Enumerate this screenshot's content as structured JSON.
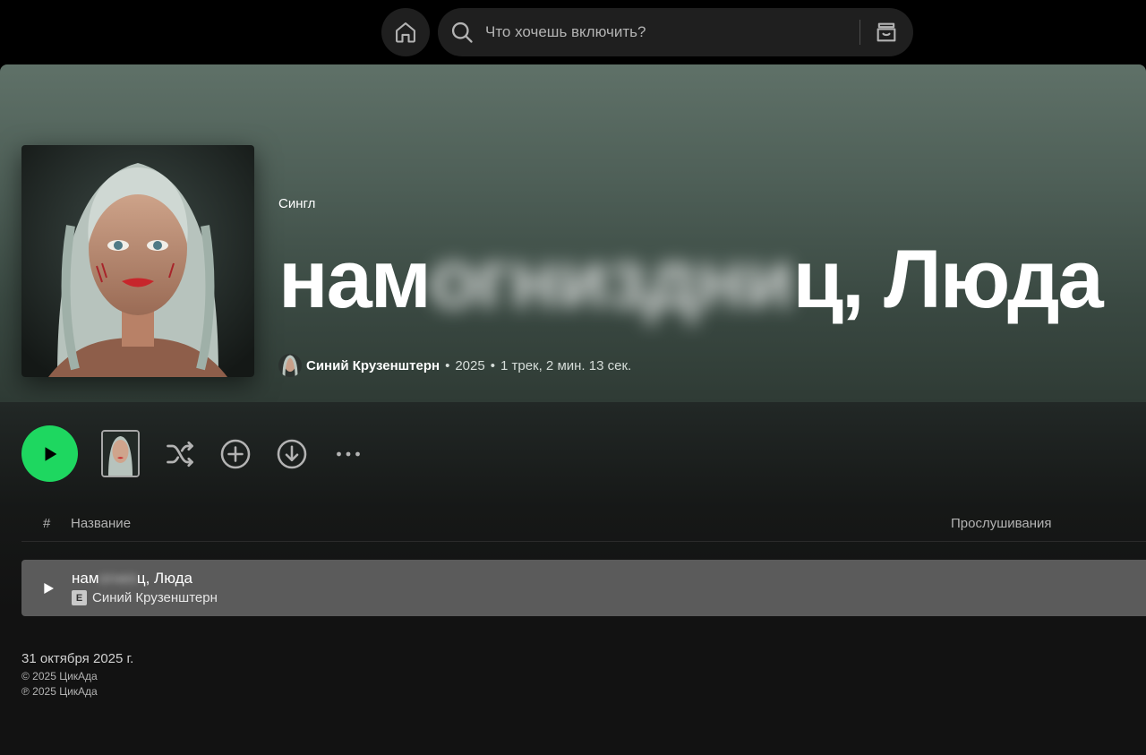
{
  "search": {
    "placeholder": "Что хочешь включить?"
  },
  "album": {
    "type_label": "Сингл",
    "title_start": "нам",
    "title_blurred": "огниздни",
    "title_end": "ц, Люда",
    "artist": "Синий Крузенштерн",
    "year": "2025",
    "tracks_duration": "1 трек, 2 мин. 13 сек.",
    "separator": "•"
  },
  "controls": {
    "play": "play-icon",
    "shuffle": "shuffle-icon",
    "add": "add-circle-icon",
    "download": "download-icon",
    "more": "more-icon"
  },
  "table": {
    "col_number": "#",
    "col_title": "Название",
    "col_plays": "Прослушивания",
    "rows": [
      {
        "title_start": "нам",
        "title_blurred": "огниз",
        "title_end": "ц, Люда",
        "explicit": "E",
        "artist": "Синий Крузенштерн"
      }
    ]
  },
  "footer": {
    "release_date": "31 октября 2025 г.",
    "copyright": "© 2025 ЦикАда",
    "phonogram": "℗ 2025 ЦикАда"
  },
  "colors": {
    "accent": "#1ed760",
    "hero_top": "#5f7168",
    "hero_bottom": "#2f3b35"
  }
}
